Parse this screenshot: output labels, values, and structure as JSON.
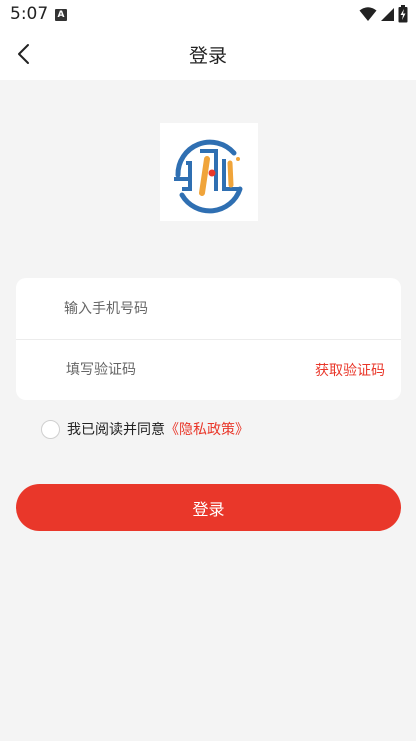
{
  "status_bar": {
    "time": "5:07",
    "notification_badge": "A",
    "icons": [
      "wifi-icon",
      "cell-signal-icon",
      "battery-charging-icon"
    ]
  },
  "header": {
    "title": "登录",
    "back_icon": "chevron-left-icon"
  },
  "logo": {
    "icon": "brand-logo"
  },
  "form": {
    "phone_placeholder": "输入手机号码",
    "phone_value": "",
    "code_placeholder": "填写验证码",
    "code_value": "",
    "get_code_label": "获取验证码"
  },
  "agreement": {
    "checked": false,
    "text": "我已阅读并同意",
    "policy_link": "《隐私政策》"
  },
  "login_button": "登录",
  "colors": {
    "accent": "#e9372a",
    "background": "#f4f4f4",
    "card": "#ffffff",
    "logo_blue": "#2f6fb2",
    "logo_orange": "#f0a43a"
  }
}
